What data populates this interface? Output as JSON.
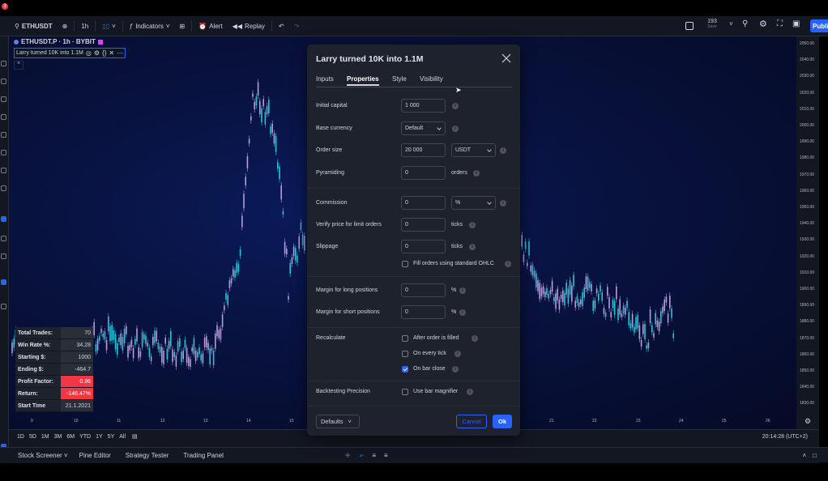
{
  "topbar": {
    "notification_count": "3",
    "symbol": "ETHUSDT",
    "interval": "1h",
    "indicators_label": "Indicators",
    "alert_label": "Alert",
    "replay_label": "Replay",
    "save_count": "193",
    "save_label": "Save",
    "publish_label": "Publi"
  },
  "legend": {
    "symbol_line": "ETHUSDT.P · 1h · BYBIT",
    "study_name": "Larry turned 10K into 1.1M"
  },
  "price_scale": [
    "2050.00",
    "2040.00",
    "2030.00",
    "2020.00",
    "2010.00",
    "2000.00",
    "1990.00",
    "1980.00",
    "1970.00",
    "1960.00",
    "1950.00",
    "1940.00",
    "1930.00",
    "1920.00",
    "1910.00",
    "1900.00",
    "1890.00",
    "1880.00",
    "1870.00",
    "1860.00",
    "1850.00",
    "1840.00",
    "1830.00"
  ],
  "time_axis": [
    "9",
    "10",
    "11",
    "12",
    "13",
    "14",
    "15",
    "21",
    "22",
    "23",
    "24",
    "25",
    "26"
  ],
  "stats": [
    {
      "key": "Total Trades:",
      "value": "70",
      "negative": false
    },
    {
      "key": "Win Rate %:",
      "value": "34.28",
      "negative": false
    },
    {
      "key": "Starting $:",
      "value": "1000",
      "negative": false
    },
    {
      "key": "Ending $:",
      "value": "-464.7",
      "negative": false
    },
    {
      "key": "Profit Factor:",
      "value": "0.96",
      "negative": true
    },
    {
      "key": "Return:",
      "value": "-146.47%",
      "negative": true
    },
    {
      "key": "Start Time",
      "value": "21.1.2021",
      "negative": false
    }
  ],
  "ranges": [
    "1D",
    "5D",
    "1M",
    "3M",
    "6M",
    "YTD",
    "1Y",
    "5Y",
    "All"
  ],
  "clock": "20:14:28 (UTC+2)",
  "footer": {
    "stock_screener": "Stock Screener",
    "pine_editor": "Pine Editor",
    "strategy_tester": "Strategy Tester",
    "trading_panel": "Trading Panel"
  },
  "dialog": {
    "title": "Larry turned 10K into 1.1M",
    "tabs": [
      "Inputs",
      "Properties",
      "Style",
      "Visibility"
    ],
    "initial_capital_label": "Initial capital",
    "initial_capital_value": "1 000",
    "base_currency_label": "Base currency",
    "base_currency_value": "Default",
    "order_size_label": "Order size",
    "order_size_value": "20 000",
    "order_size_unit": "USDT",
    "pyramiding_label": "Pyramiding",
    "pyramiding_value": "0",
    "pyramiding_unit": "orders",
    "commission_label": "Commission",
    "commission_value": "0",
    "commission_unit": "%",
    "verify_price_label": "Verify price for limit orders",
    "verify_price_value": "0",
    "verify_price_unit": "ticks",
    "slippage_label": "Slippage",
    "slippage_value": "0",
    "slippage_unit": "ticks",
    "fill_ohlc_label": "Fill orders using standard OHLC",
    "margin_long_label": "Margin for long positions",
    "margin_long_value": "0",
    "margin_long_unit": "%",
    "margin_short_label": "Margin for short positions",
    "margin_short_value": "0",
    "margin_short_unit": "%",
    "recalculate_label": "Recalculate",
    "after_order_label": "After order is filled",
    "every_tick_label": "On every tick",
    "bar_close_label": "On bar close",
    "backtesting_label": "Backtesting Precision",
    "bar_magnifier_label": "Use bar magnifier",
    "defaults_label": "Defaults",
    "cancel_label": "Cancel",
    "ok_label": "Ok"
  },
  "colors": {
    "accent": "#2962ff",
    "negative": "#f23645",
    "bull": "#26c6da",
    "bear": "#b39ddb"
  }
}
